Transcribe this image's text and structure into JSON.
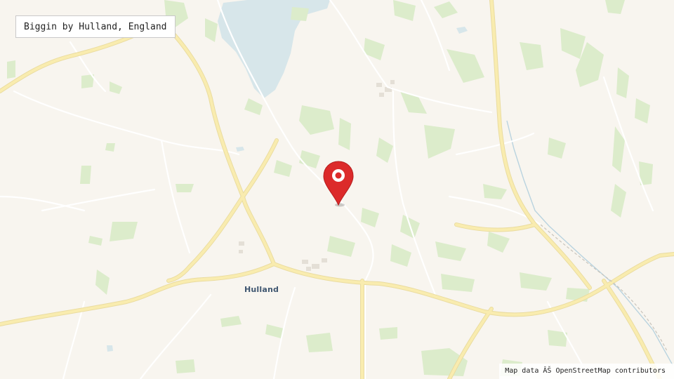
{
  "place_name": "Biggin by Hulland, England",
  "town_label": "Hulland",
  "attribution": "Map data ÂŠ OpenStreetMap contributors",
  "colors": {
    "land": "#f8f5ef",
    "water": "#d7e6ea",
    "field": "#dceccb",
    "road_major": "#f7e9a7",
    "road_minor": "#ffffff",
    "pin": "#dc2a2a"
  },
  "icons": {
    "marker": "map-pin-icon"
  }
}
